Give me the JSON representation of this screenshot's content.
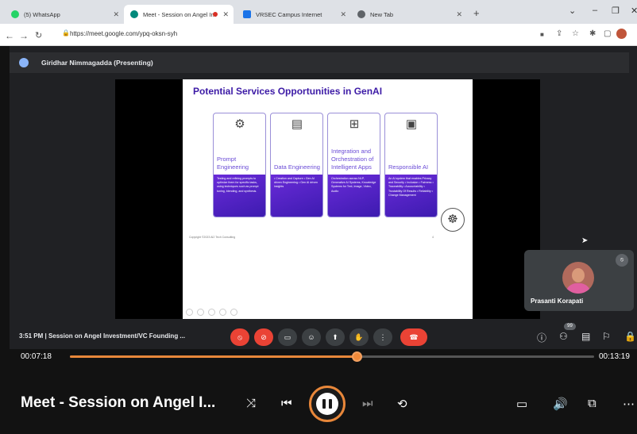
{
  "browser": {
    "tabs": [
      {
        "label": "(5) WhatsApp",
        "color": "#25d366"
      },
      {
        "label": "Meet - Session on Angel Inv",
        "color": "#00897b"
      },
      {
        "label": "VRSEC Campus Internet",
        "color": "#1a73e8"
      },
      {
        "label": "New Tab",
        "color": "#5f6368"
      }
    ],
    "new_tab_label": "+",
    "url": "https://meet.google.com/ypq-oksn-syh"
  },
  "meet": {
    "presenter": "Giridhar Nimmagadda (Presenting)",
    "participant_name": "Prasanti Korapati",
    "call_time": "3:51 PM",
    "call_title": "Session on Angel Investment/VC Founding ...",
    "participant_count": "99"
  },
  "slide": {
    "title": "Potential Services Opportunities in GenAI",
    "cards": [
      {
        "title": "Prompt Engineering",
        "icon": "gear-icon",
        "desc": "Testing and refining prompts to optimize them for specific tasks, using techniques such as prompt tuning, blending, and synthesis."
      },
      {
        "title": "Data Engineering",
        "icon": "data-chart-icon",
        "desc": "• Creation and Capture • Gen AI driven Engineering • Gen AI driven insights"
      },
      {
        "title": "Integration and Orchestration of Intelligent Apps",
        "icon": "apps-grid-icon",
        "desc": "Orchestration across NLP, Generative AI Systems, Knowledge Systems for Text, Image, Video, Audio"
      },
      {
        "title": "Responsible AI",
        "icon": "monitor-icon",
        "desc": "An AI system that enables Privacy and Security • Inclusion • Fairness • Traceability • Accountability • Trustability Of Results • Reliability • Change Management"
      }
    ],
    "copyright": "Copyright ©2023 AI2 Tech Consulting",
    "page_number": "4"
  },
  "player": {
    "elapsed": "00:07:18",
    "total": "00:13:19",
    "progress": 0.548,
    "title": "Meet - Session on Angel I..."
  }
}
